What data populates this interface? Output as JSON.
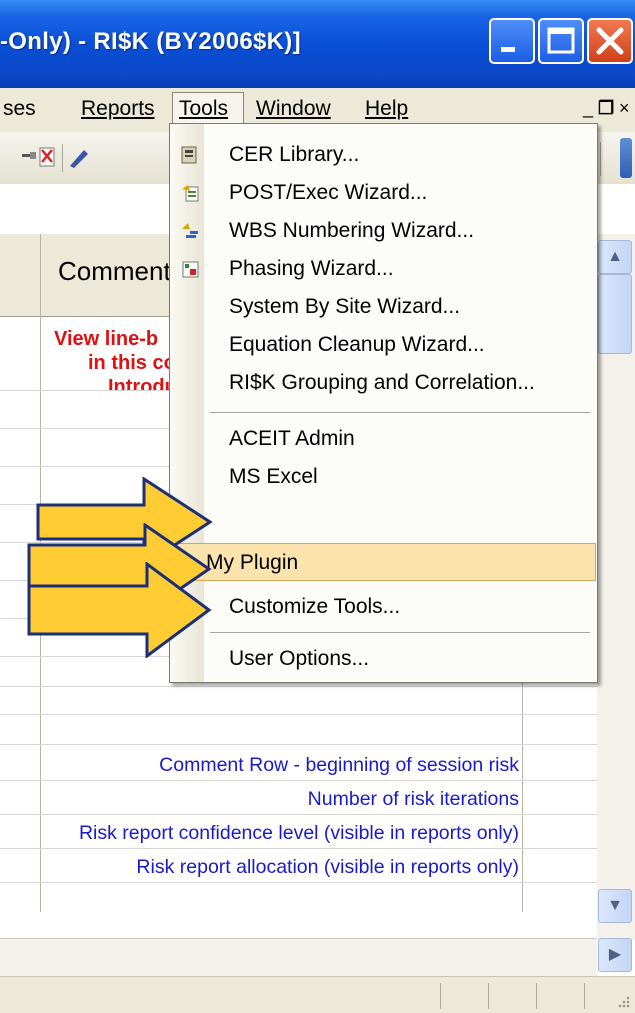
{
  "window": {
    "title": "-Only) - RI$K (BY2006$K)]",
    "controls": [
      "minimize-icon",
      "restore-icon",
      "close-icon"
    ]
  },
  "menubar": {
    "items": [
      {
        "label": "ses",
        "underline": false
      },
      {
        "label": "Reports",
        "underline": true
      },
      {
        "label": "Tools",
        "underline": true,
        "active": true
      },
      {
        "label": "Window",
        "underline": true
      },
      {
        "label": "Help",
        "underline": true
      }
    ],
    "mdi_controls": "_ ꟾ×"
  },
  "tools_menu": {
    "items": [
      {
        "label": "CER Library...",
        "icon": "cer-library-icon"
      },
      {
        "label": "POST/Exec Wizard...",
        "icon": "post-exec-icon"
      },
      {
        "label": "WBS Numbering Wizard...",
        "icon": "wbs-numbering-icon"
      },
      {
        "label": "Phasing Wizard...",
        "icon": "phasing-wizard-icon"
      },
      {
        "label": "System By Site Wizard..."
      },
      {
        "label": "Equation Cleanup Wizard..."
      },
      {
        "label": "RI$K Grouping and Correlation..."
      },
      {
        "label": "ACEIT Admin"
      },
      {
        "label": "MS Excel"
      },
      {
        "label": "My Plugin",
        "highlighted": true
      },
      {
        "label": "Customize Tools..."
      },
      {
        "label": "User Options..."
      }
    ]
  },
  "sheet": {
    "column_header": "Comment",
    "red_notes": [
      "View line-b",
      "in this co",
      "Introdu"
    ],
    "blue_rows": [
      "Comment Row - beginning of session risk",
      "Number of risk iterations",
      "Risk report confidence level (visible in reports only)",
      "Risk report allocation (visible in reports only)"
    ]
  },
  "annotations": {
    "arrow_color": "#ffcc33",
    "arrow_outline": "#1b2f7a",
    "count": 3
  },
  "colors": {
    "title_bar": "#0a4fd6",
    "menu_highlight": "#fbe3ad",
    "blue_text": "#1a1acc",
    "red_text": "#e01010"
  }
}
